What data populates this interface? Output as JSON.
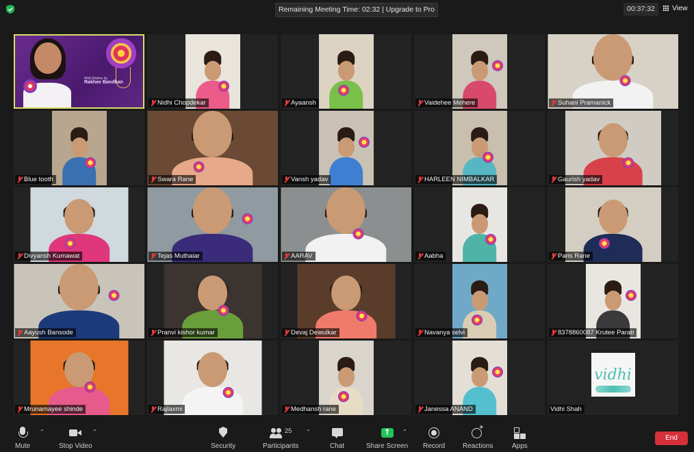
{
  "top_bar": {
    "meeting_timer": "Remaining Meeting Time: 02:32 | Upgrade to Pro",
    "clock": "00:37:32",
    "view_label": "View"
  },
  "participants": [
    {
      "name": "",
      "host": true
    },
    {
      "name": "Nidhi Chopdekar",
      "shirt": "#ec5c8a",
      "bg": "#e9e4dc"
    },
    {
      "name": "Ayaansh",
      "shirt": "#79c04a",
      "bg": "#dcd3c2"
    },
    {
      "name": "Vaidehee Mehere",
      "shirt": "#d9496a",
      "bg": "#cfc8bd"
    },
    {
      "name": "Suhani Pramanick",
      "shirt": "#f2f2f2",
      "bg": "#d8d2c6"
    },
    {
      "name": "Blue tooth",
      "shirt": "#3a6fb0",
      "bg": "#b8a68e"
    },
    {
      "name": "Swara Rane",
      "shirt": "#e8a88a",
      "bg": "#6a4a34"
    },
    {
      "name": "Vansh yadav",
      "shirt": "#3e7fd1",
      "bg": "#c9c1b3"
    },
    {
      "name": "HARLEEN NIMBALKAR",
      "shirt": "#56b6c2",
      "bg": "#c8bfae"
    },
    {
      "name": "Gaurish yadav",
      "shirt": "#d9414a",
      "bg": "#d0ccc4"
    },
    {
      "name": "Divyansh Kumawat",
      "shirt": "#e0367a",
      "bg": "#cfd9de"
    },
    {
      "name": "Tejas Muthaiar",
      "shirt": "#3a2c7a",
      "bg": "#8f9aa1"
    },
    {
      "name": "AARAV",
      "shirt": "#f2f2f2",
      "bg": "#8b8f8f"
    },
    {
      "name": "Aabha",
      "shirt": "#4fb3a8",
      "bg": "#e8e6e2"
    },
    {
      "name": "Paris Rane",
      "shirt": "#1f2c58",
      "bg": "#d3cdc2"
    },
    {
      "name": "Aayush Bansode",
      "shirt": "#1d3a7a",
      "bg": "#c9c4ba"
    },
    {
      "name": "Pranvi kishor kumar",
      "shirt": "#6a9e3a",
      "bg": "#3c3430"
    },
    {
      "name": "Devaj Dewulkar",
      "shirt": "#f07b6a",
      "bg": "#5a3c2a"
    },
    {
      "name": "Navanya selvi",
      "shirt": "#d9cdb4",
      "bg": "#6fa9c7"
    },
    {
      "name": "8378860087 Krutee Parab",
      "shirt": "#3a3a3a",
      "bg": "#e9e6e2"
    },
    {
      "name": "Mrunamayee shinde",
      "shirt": "#e65a8c",
      "bg": "#e7762a"
    },
    {
      "name": "Rajlaxmi",
      "shirt": "#f4f4f4",
      "bg": "#e9e7e4"
    },
    {
      "name": "Medhansh rane",
      "shirt": "#e9dcc6",
      "bg": "#d9d4cc"
    },
    {
      "name": "Janessa ANAND",
      "shirt": "#54c0cf",
      "bg": "#e3ded6"
    },
    {
      "name": "Vidhi Shah",
      "logo": "vidhi"
    }
  ],
  "host_card": {
    "line1": "Well Wishes by",
    "line2": "Rakhee Bandhan"
  },
  "vidhi_logo": "vidhi",
  "toolbar": {
    "mute": "Mute",
    "stop_video": "Stop Video",
    "security": "Security",
    "participants": "Participants",
    "participants_count": "25",
    "chat": "Chat",
    "share_screen": "Share Screen",
    "record": "Record",
    "reactions": "Reactions",
    "apps": "Apps",
    "end": "End"
  },
  "colors": {
    "end_button": "#d6303b",
    "share_screen": "#23c35a",
    "active_speaker_border": "#d8e067",
    "muted_mic": "#e23b3b"
  }
}
